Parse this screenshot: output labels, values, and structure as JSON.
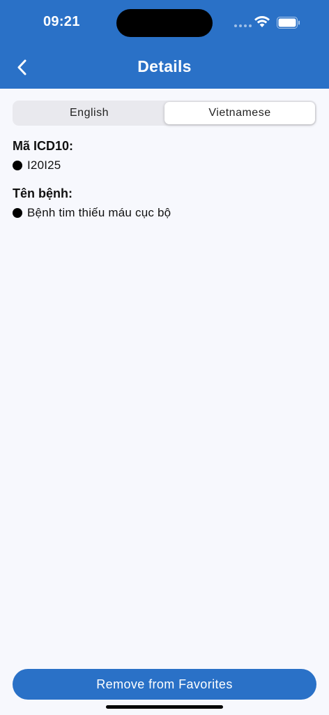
{
  "status_bar": {
    "time": "09:21"
  },
  "header": {
    "title": "Details"
  },
  "tabs": [
    {
      "label": "English",
      "active": false
    },
    {
      "label": "Vietnamese",
      "active": true
    }
  ],
  "details": {
    "icd_label": "Mã ICD10:",
    "icd_value": "I20I25",
    "disease_label": "Tên bệnh:",
    "disease_value": "Bệnh tim thiếu máu cục bộ"
  },
  "footer": {
    "remove_label": "Remove from Favorites"
  },
  "colors": {
    "primary": "#2a71c7",
    "background": "#f7f8fd"
  },
  "icons": [
    "back-chevron",
    "wifi",
    "battery",
    "signal"
  ]
}
